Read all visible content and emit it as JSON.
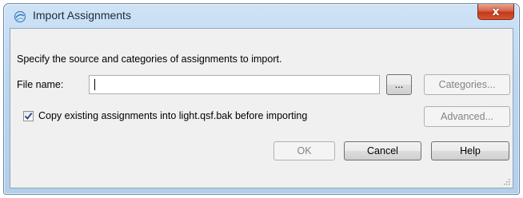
{
  "window": {
    "title": "Import Assignments",
    "close_glyph": "x",
    "app_icon": "app-icon",
    "titlebar_color": "#bcd6ef",
    "close_color": "#c2391c"
  },
  "dialog": {
    "instructions": "Specify the source and categories of assignments to import.",
    "file_name_label": "File name:",
    "file_name_value": "",
    "browse_label": "...",
    "categories_label": "Categories...",
    "copy_checkbox_label": "Copy existing assignments into light.qsf.bak before importing",
    "copy_checked": true,
    "advanced_label": "Advanced...",
    "ok_label": "OK",
    "cancel_label": "Cancel",
    "help_label": "Help"
  }
}
